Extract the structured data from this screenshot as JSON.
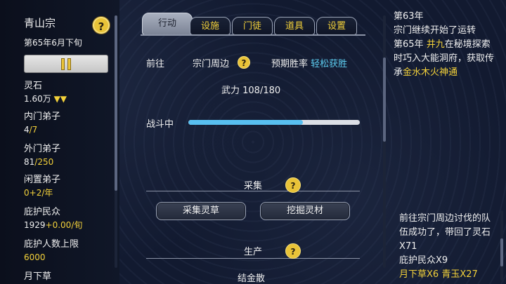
{
  "sect": {
    "name": "青山宗",
    "date": "第65年6月下旬"
  },
  "help_symbol": "?",
  "resources": [
    {
      "label": "灵石",
      "value": "1.60万",
      "delta": "▼▼",
      "extra": ""
    },
    {
      "label": "内门弟子",
      "value": "4",
      "delta": "",
      "extra": "/7"
    },
    {
      "label": "外门弟子",
      "value": "81",
      "delta": "",
      "extra": "/250"
    },
    {
      "label": "闲置弟子",
      "value": "0",
      "delta": "+2/年",
      "extra": ""
    },
    {
      "label": "庇护民众",
      "value": "1929",
      "delta": "+0.00/旬",
      "extra": ""
    },
    {
      "label": "庇护人数上限",
      "value": "",
      "delta": "6000",
      "extra": ""
    },
    {
      "label": "月下草",
      "value": "",
      "delta": "",
      "extra": ""
    }
  ],
  "tabs": [
    {
      "label": "行动",
      "active": true
    },
    {
      "label": "设施",
      "active": false
    },
    {
      "label": "门徒",
      "active": false
    },
    {
      "label": "道具",
      "active": false
    },
    {
      "label": "设置",
      "active": false
    }
  ],
  "action": {
    "goto_label": "前往",
    "destination": "宗门周边",
    "winrate_label": "预期胜率",
    "winrate_value": "轻松获胜",
    "power_text": "武力 108/180",
    "battle_label": "战斗中",
    "battle_progress": 0.67
  },
  "gather": {
    "title": "采集",
    "buttons": [
      "采集灵草",
      "挖掘灵材"
    ]
  },
  "produce": {
    "title": "生产",
    "first_item": "结金散"
  },
  "log": {
    "top": [
      {
        "parts": [
          {
            "text": "第63年",
            "color": "#f0f0f0"
          }
        ]
      },
      {
        "parts": [
          {
            "text": "宗门继续开始了运转",
            "color": "#f0f0f0"
          }
        ]
      },
      {
        "parts": [
          {
            "text": "第65年 ",
            "color": "#f0f0f0"
          },
          {
            "text": "井九",
            "color": "#f3d13a"
          },
          {
            "text": "在秘境探索时巧入大能洞府，获取传承",
            "color": "#f0f0f0"
          },
          {
            "text": "金水木火神通",
            "color": "#f3d13a"
          }
        ]
      }
    ],
    "bottom": [
      {
        "parts": [
          {
            "text": "前往宗门周边讨伐的队伍成功了，带回了灵石X71",
            "color": "#f0f0f0"
          }
        ]
      },
      {
        "parts": [
          {
            "text": "庇护民众X9",
            "color": "#f0f0f0"
          }
        ]
      },
      {
        "parts": [
          {
            "text": "月下草X6 ",
            "color": "#f3d13a"
          },
          {
            "text": "青玉X27",
            "color": "#f3d13a"
          }
        ]
      }
    ]
  }
}
